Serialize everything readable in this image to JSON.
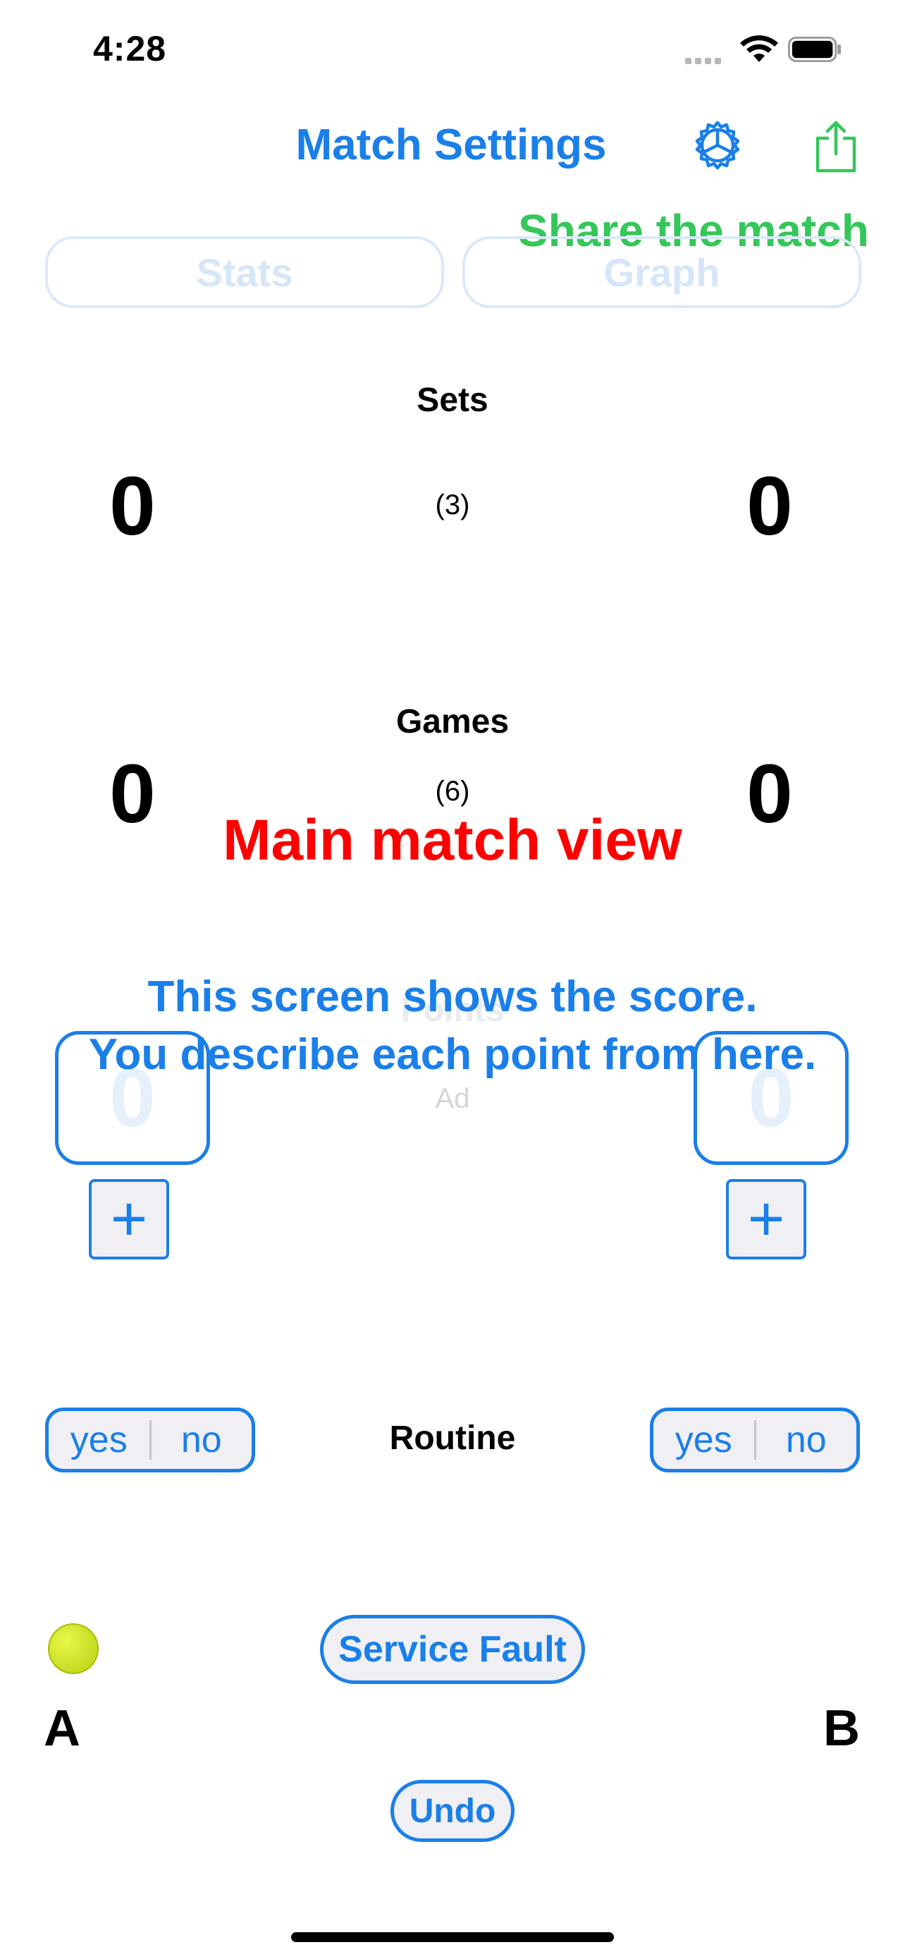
{
  "status_bar": {
    "time": "4:28"
  },
  "nav": {
    "title": "Match Settings",
    "settings_icon": "gear-icon",
    "share_icon": "share-icon",
    "share_label": "Share the match"
  },
  "tabs": [
    {
      "label": "Stats"
    },
    {
      "label": "Graph"
    }
  ],
  "sets": {
    "label": "Sets",
    "player_a": "0",
    "player_b": "0",
    "best_of": "(3)"
  },
  "games": {
    "label": "Games",
    "player_a": "0",
    "player_b": "0",
    "per_set": "(6)"
  },
  "points": {
    "label": "Points",
    "player_a": "0",
    "player_b": "0",
    "mode": "Ad"
  },
  "overlay": {
    "title": "Main match view",
    "line1": "This screen shows the score.",
    "line2": "You describe each point from here."
  },
  "controls": {
    "plus_a": "+",
    "plus_b": "+",
    "routine_label": "Routine",
    "routine_a": {
      "yes": "yes",
      "no": "no"
    },
    "routine_b": {
      "yes": "yes",
      "no": "no"
    },
    "service_fault": "Service Fault",
    "undo": "Undo"
  },
  "players": {
    "a": "A",
    "b": "B",
    "server_icon": "tennis-ball-icon"
  },
  "colors": {
    "accent": "#1a7fe8",
    "share_green": "#34c759",
    "overlay_red": "#ff0000"
  }
}
